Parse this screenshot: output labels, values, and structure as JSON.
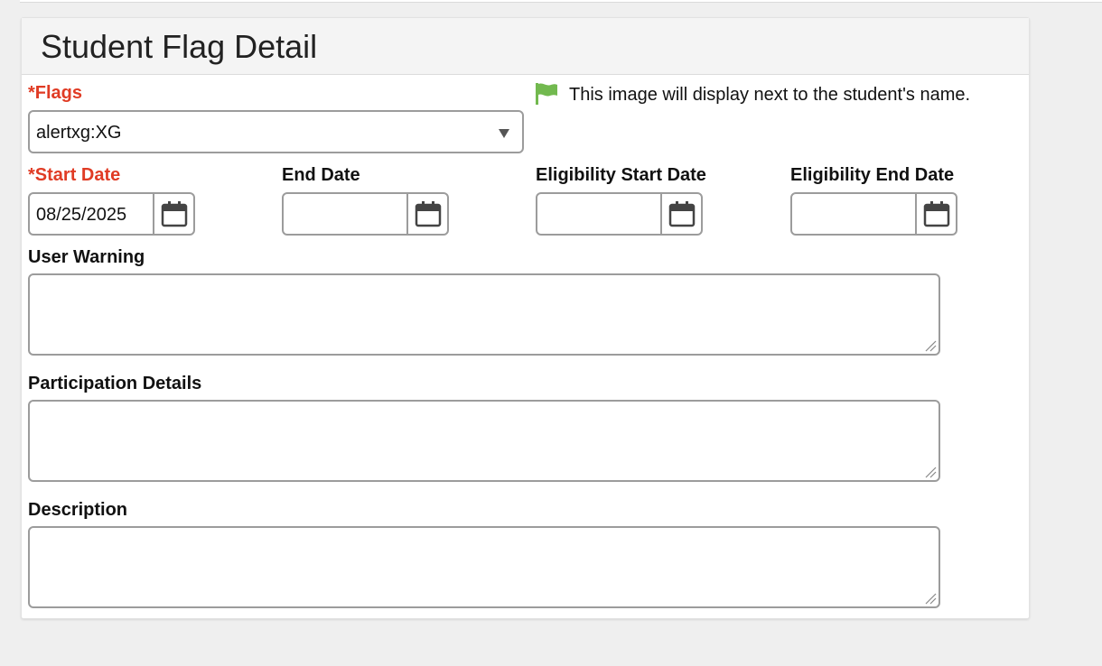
{
  "panel": {
    "title": "Student Flag Detail"
  },
  "flags": {
    "label": "*Flags",
    "selected": "alertxg:XG",
    "note": "This image will display next to the student's name.",
    "flag_color": "#72b94f"
  },
  "dates": {
    "start": {
      "label": "*Start Date",
      "value": "08/25/2025"
    },
    "end": {
      "label": "End Date",
      "value": ""
    },
    "eligibility_start": {
      "label": "Eligibility Start Date",
      "value": ""
    },
    "eligibility_end": {
      "label": "Eligibility End Date",
      "value": ""
    }
  },
  "fields": {
    "user_warning": {
      "label": "User Warning",
      "value": ""
    },
    "participation_details": {
      "label": "Participation Details",
      "value": ""
    },
    "description": {
      "label": "Description",
      "value": ""
    }
  },
  "colors": {
    "required": "#e03b24",
    "border": "#9c9c9c"
  }
}
